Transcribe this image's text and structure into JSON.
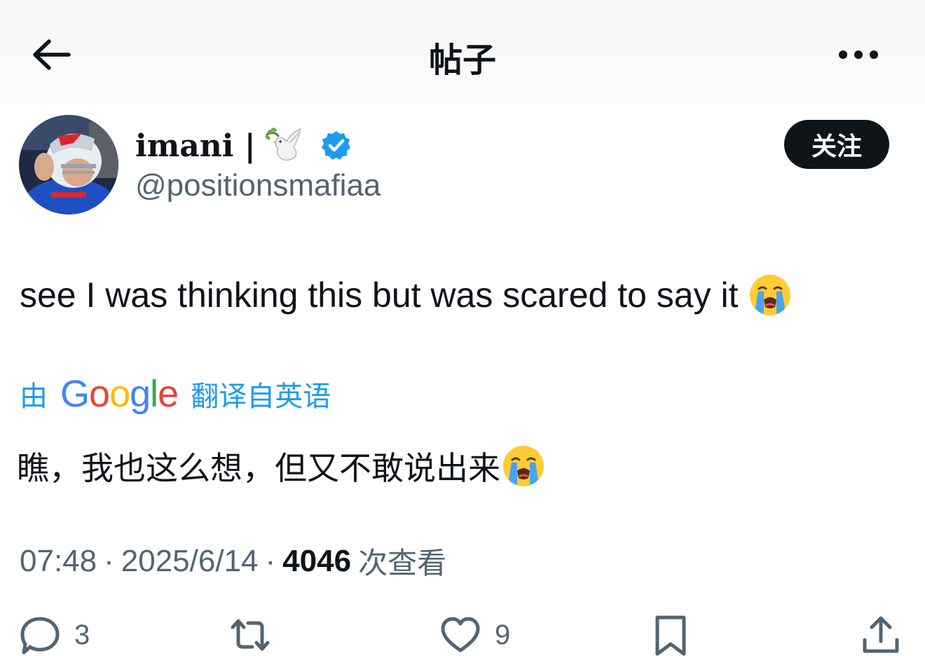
{
  "header": {
    "title": "帖子",
    "back_icon": "arrow-left-icon",
    "more_icon": "more-horizontal-icon"
  },
  "author": {
    "display_name": "imani |",
    "name_emoji": "dove-icon",
    "verified_icon": "verified-badge-icon",
    "handle": "@positionsmafiaa",
    "follow_label": "关注"
  },
  "post": {
    "text": "see I was thinking this but was scared to say it",
    "emoji": "loudly-crying-face-emoji",
    "translate_prefix": "由",
    "translate_brand": "Google",
    "translate_suffix": "翻译自英语",
    "translated_text": "瞧，我也这么想，但又不敢说出来",
    "time": "07:48",
    "date": "2025/6/14",
    "separator": "·",
    "views": "4046",
    "views_label": "次查看"
  },
  "actions": {
    "reply_count": "3",
    "like_count": "9"
  },
  "colors": {
    "text": "#0f1419",
    "secondary": "#536471",
    "link": "#1d9bf0",
    "verified": "#1d9bf0",
    "button_bg": "#0f1419"
  }
}
